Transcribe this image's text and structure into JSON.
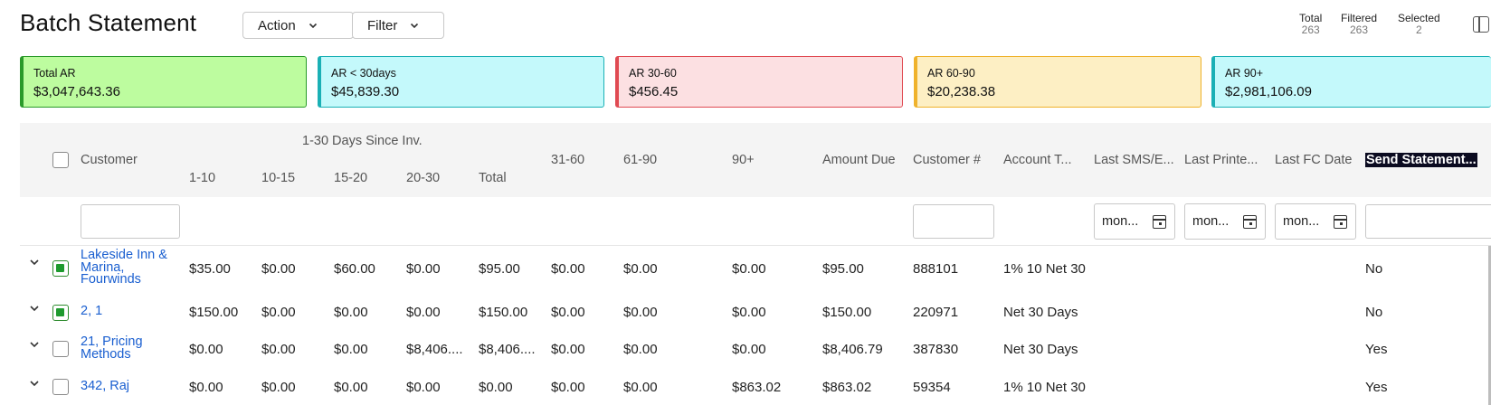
{
  "header": {
    "title": "Batch Statement",
    "action_label": "Action",
    "filter_label": "Filter",
    "stats": [
      {
        "label": "Total",
        "value": "263"
      },
      {
        "label": "Filtered",
        "value": "263"
      },
      {
        "label": "Selected",
        "value": "2"
      }
    ]
  },
  "cards": [
    {
      "label": "Total AR",
      "value": "$3,047,643.36",
      "bg": "#bdfc9f",
      "accent": "#2a9a2a"
    },
    {
      "label": "AR < 30days",
      "value": "$45,839.30",
      "bg": "#c4f9fb",
      "accent": "#1ab0b5"
    },
    {
      "label": "AR 30-60",
      "value": "$456.45",
      "bg": "#fce0e2",
      "accent": "#e04a52"
    },
    {
      "label": "AR 60-90",
      "value": "$20,238.38",
      "bg": "#fdefc4",
      "accent": "#efb22c"
    },
    {
      "label": "AR 90+",
      "value": "$2,981,106.09",
      "bg": "#c4f9fb",
      "accent": "#1ab0b5"
    }
  ],
  "columns": {
    "customer": "Customer",
    "group_label": "1-30 Days Since Inv.",
    "d1_10": "1-10",
    "d10_15": "10-15",
    "d15_20": "15-20",
    "d20_30": "20-30",
    "total": "Total",
    "d31_60": "31-60",
    "d61_90": "61-90",
    "d90plus": "90+",
    "amount_due": "Amount Due",
    "customer_no": "Customer #",
    "account_terms": "Account T...",
    "last_sms": "Last SMS/E...",
    "last_printed": "Last Printe...",
    "last_fc": "Last FC Date",
    "send_statement": "Send Statement..."
  },
  "filters": {
    "date_placeholder_1": "mon...",
    "date_placeholder_2": "mon...",
    "date_placeholder_3": "mon..."
  },
  "rows": [
    {
      "customer": "Lakeside Inn & Marina, Fourwinds",
      "checked": true,
      "d1_10": "$35.00",
      "d10_15": "$0.00",
      "d15_20": "$60.00",
      "d20_30": "$0.00",
      "total": "$95.00",
      "d31_60": "$0.00",
      "d61_90": "$0.00",
      "d90plus": "$0.00",
      "amount_due": "$95.00",
      "customer_no": "888101",
      "terms": "1% 10 Net 30",
      "send": "No"
    },
    {
      "customer": "2, 1",
      "checked": true,
      "d1_10": "$150.00",
      "d10_15": "$0.00",
      "d15_20": "$0.00",
      "d20_30": "$0.00",
      "total": "$150.00",
      "d31_60": "$0.00",
      "d61_90": "$0.00",
      "d90plus": "$0.00",
      "amount_due": "$150.00",
      "customer_no": "220971",
      "terms": "Net 30 Days",
      "send": "No"
    },
    {
      "customer": "21, Pricing Methods",
      "checked": false,
      "d1_10": "$0.00",
      "d10_15": "$0.00",
      "d15_20": "$0.00",
      "d20_30": "$8,406....",
      "total": "$8,406....",
      "d31_60": "$0.00",
      "d61_90": "$0.00",
      "d90plus": "$0.00",
      "amount_due": "$8,406.79",
      "customer_no": "387830",
      "terms": "Net 30 Days",
      "send": "Yes"
    },
    {
      "customer": "342, Raj",
      "checked": false,
      "d1_10": "$0.00",
      "d10_15": "$0.00",
      "d15_20": "$0.00",
      "d20_30": "$0.00",
      "total": "$0.00",
      "d31_60": "$0.00",
      "d61_90": "$0.00",
      "d90plus": "$863.02",
      "amount_due": "$863.02",
      "customer_no": "59354",
      "terms": "1% 10 Net 30",
      "send": "Yes"
    }
  ]
}
